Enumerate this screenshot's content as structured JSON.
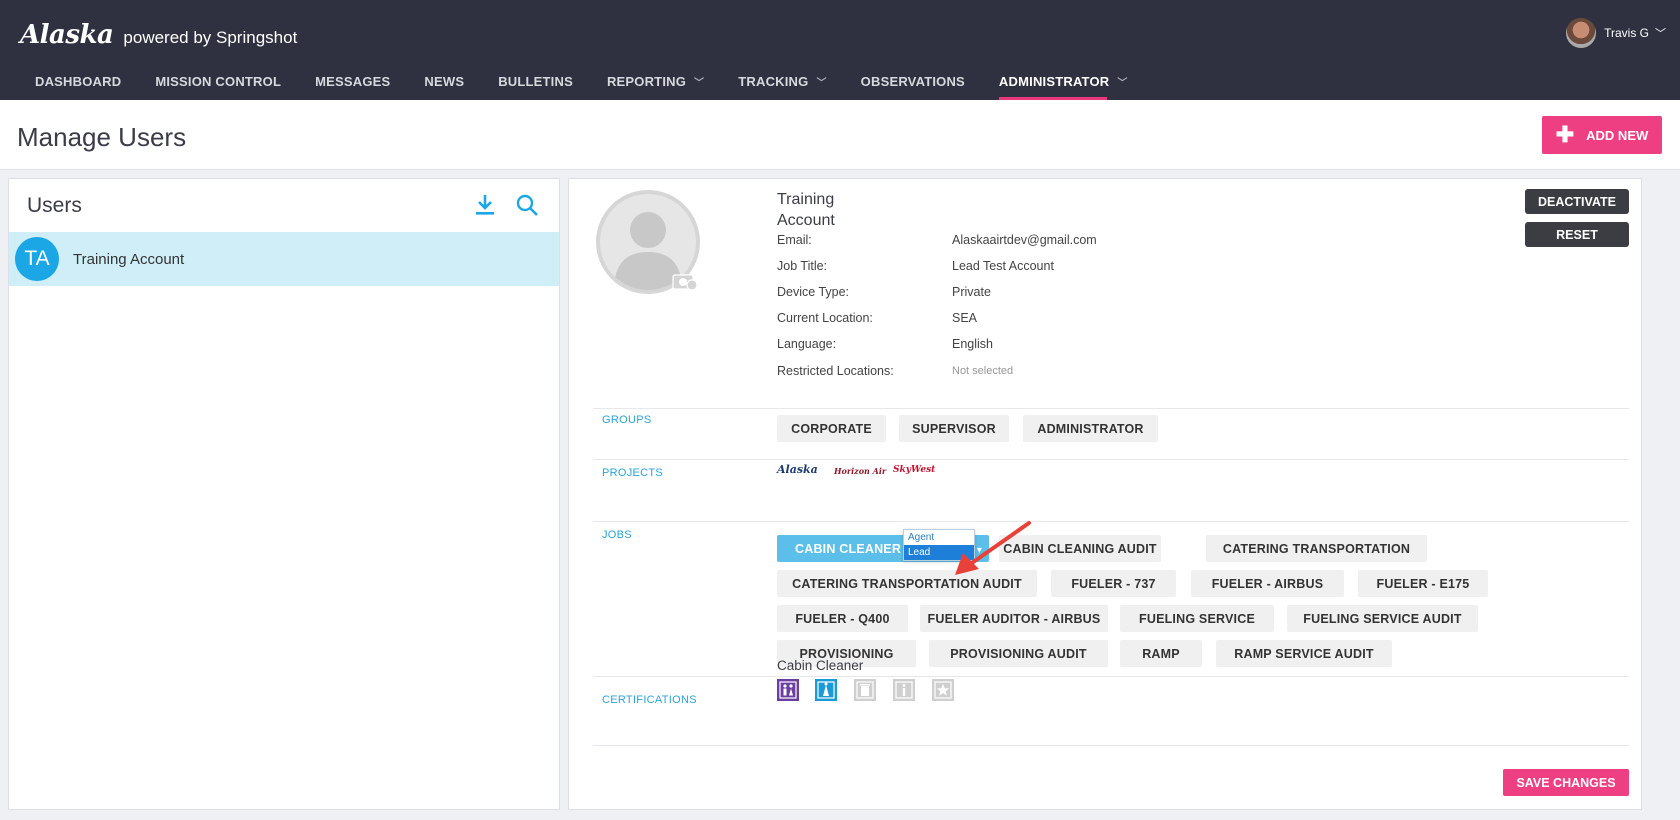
{
  "brand": {
    "logo": "Alaska",
    "subtitle": "powered by Springshot"
  },
  "user_menu": {
    "name": "Travis G"
  },
  "nav": [
    {
      "label": "DASHBOARD",
      "dropdown": false
    },
    {
      "label": "MISSION CONTROL",
      "dropdown": false
    },
    {
      "label": "MESSAGES",
      "dropdown": false
    },
    {
      "label": "NEWS",
      "dropdown": false
    },
    {
      "label": "BULLETINS",
      "dropdown": false
    },
    {
      "label": "REPORTING",
      "dropdown": true
    },
    {
      "label": "TRACKING",
      "dropdown": true
    },
    {
      "label": "OBSERVATIONS",
      "dropdown": false
    },
    {
      "label": "ADMINISTRATOR",
      "dropdown": true,
      "active": true
    }
  ],
  "page": {
    "title": "Manage Users",
    "add_button": "ADD NEW"
  },
  "users_panel": {
    "title": "Users",
    "users": [
      {
        "initials": "TA",
        "name": "Training Account",
        "selected": true
      }
    ]
  },
  "detail": {
    "name_line1": "Training",
    "name_line2": "Account",
    "info": [
      {
        "label": "Email:",
        "value": "Alaskaairtdev@gmail.com"
      },
      {
        "label": "Job Title:",
        "value": "Lead Test Account"
      },
      {
        "label": "Device Type:",
        "value": "Private"
      },
      {
        "label": "Current Location:",
        "value": "SEA"
      },
      {
        "label": "Language:",
        "value": "English"
      },
      {
        "label": "Restricted Locations:",
        "value": "Not selected"
      }
    ],
    "deactivate_button": "DEACTIVATE",
    "reset_button": "RESET",
    "groups_label": "GROUPS",
    "groups": [
      "CORPORATE",
      "SUPERVISOR",
      "ADMINISTRATOR"
    ],
    "projects_label": "PROJECTS",
    "projects": [
      {
        "name": "Alaska",
        "color": "#1b3a73"
      },
      {
        "name": "Horizon Air",
        "color": "#8a1c2b"
      },
      {
        "name": "SkyWest",
        "color": "#c4122f"
      }
    ],
    "jobs_label": "JOBS",
    "selected_job": {
      "name": "CABIN CLEANER",
      "role": "AGENT"
    },
    "role_options": [
      "Agent",
      "Lead"
    ],
    "highlighted_role": "Lead",
    "jobs": [
      "CABIN CLEANING AUDIT",
      "CATERING TRANSPORTATION",
      "CATERING TRANSPORTATION AUDIT",
      "FUELER - 737",
      "FUELER - AIRBUS",
      "FUELER - E175",
      "FUELER - Q400",
      "FUELER AUDITOR - AIRBUS",
      "FUELING SERVICE",
      "FUELING SERVICE AUDIT",
      "PROVISIONING",
      "PROVISIONING AUDIT",
      "RAMP",
      "RAMP SERVICE AUDIT"
    ],
    "certifications_label": "CERTIFICATIONS",
    "certification_name": "Cabin Cleaner",
    "certification_icons": [
      "lavatory-icon",
      "cleaning-icon",
      "trash-icon",
      "info-icon",
      "star-icon"
    ],
    "save_button": "SAVE CHANGES"
  },
  "colors": {
    "accent_pink": "#ee3f82",
    "header_bg": "#2f3140",
    "link_blue": "#2aa4d6",
    "selected_chip": "#5bbfe9",
    "cert_purple": "#6b3fa0",
    "cert_blue": "#1b9ad6"
  }
}
